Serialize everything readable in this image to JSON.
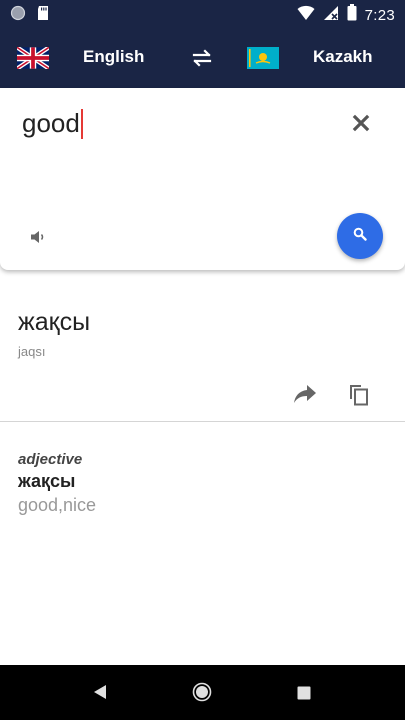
{
  "status_bar": {
    "time": "7:23",
    "icons": [
      "notification-circle-icon",
      "sd-card-icon",
      "wifi-icon",
      "cellular-off-icon",
      "battery-icon"
    ]
  },
  "toolbar": {
    "source_language": "English",
    "target_language": "Kazakh",
    "source_flag": "uk-flag-icon",
    "target_flag": "kazakhstan-flag-icon",
    "swap_icon": "swap-arrows-icon"
  },
  "input": {
    "text": "good"
  },
  "result": {
    "translation": "жақсы",
    "transliteration": "jaqsı"
  },
  "dictionary": {
    "part_of_speech": "adjective",
    "word": "жақсы",
    "meanings": "good,nice"
  },
  "colors": {
    "header": "#1a2545",
    "search_button": "#2e6ce6",
    "caret": "#e53935"
  }
}
